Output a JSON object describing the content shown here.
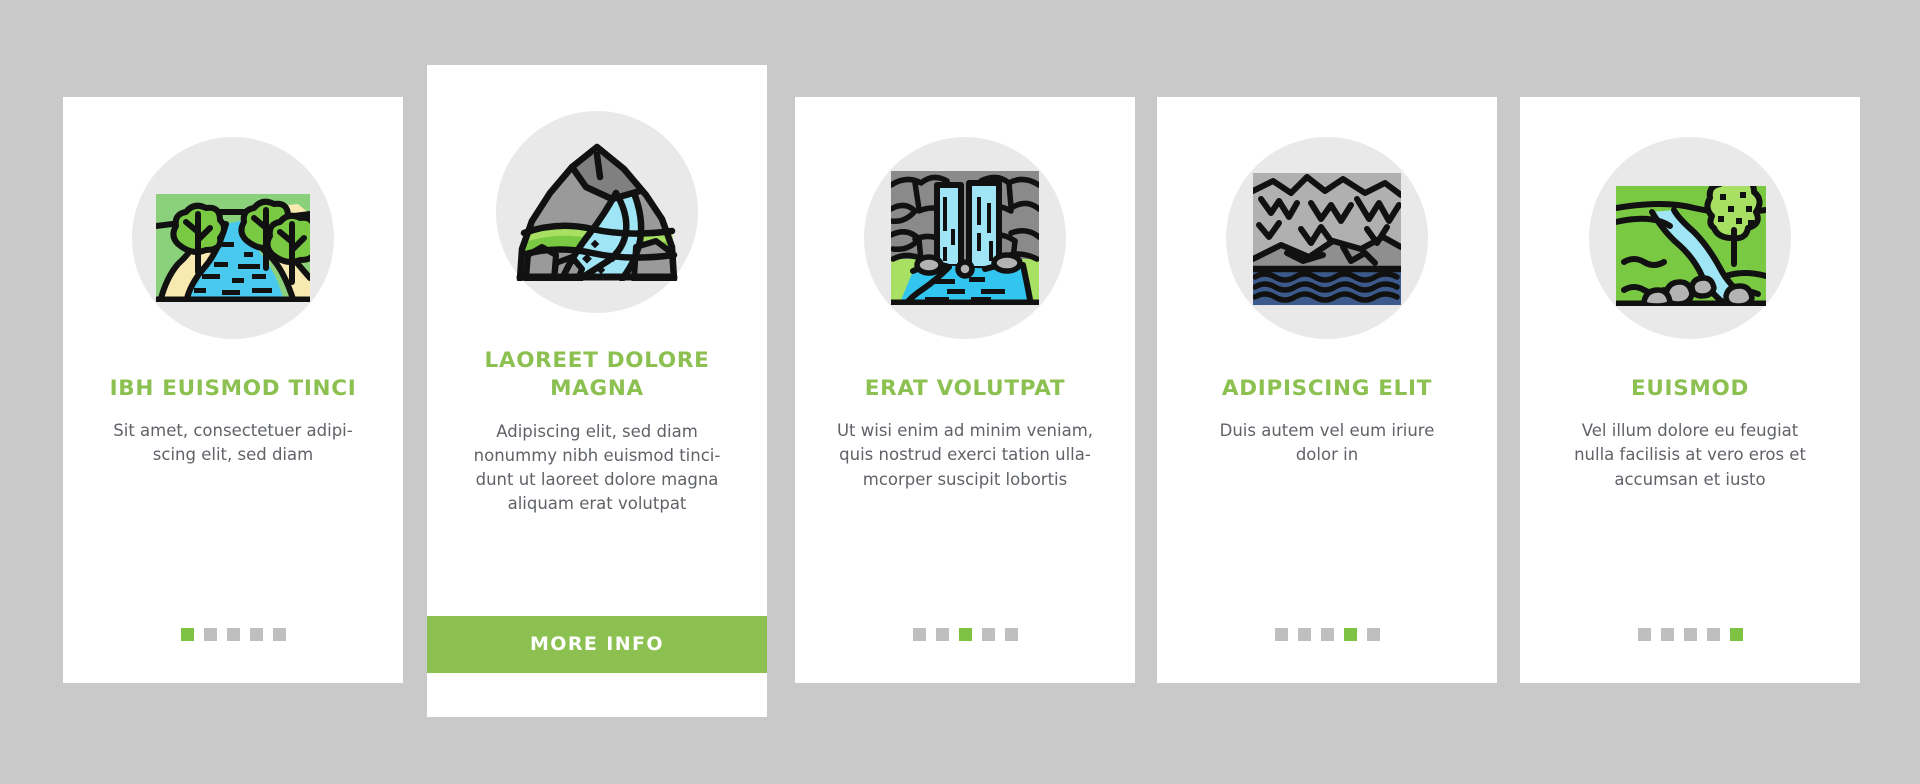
{
  "background_color": "#c9c9c9",
  "theme": {
    "accent_green": "#8cc152",
    "dot_active": "#7dc242",
    "dot_inactive": "#bfbfbf",
    "icon_circle": "#e9e9e9",
    "card_background": "#ffffff",
    "title_color": "#8cc152",
    "body_color": "#5f6368"
  },
  "cards": [
    {
      "icon_name": "river-with-trees-icon",
      "title": "IBH EUISMOD TINCI",
      "description": "Sit amet, consectetuer adipi-\nscing elit, sed diam",
      "featured": false,
      "dots": {
        "total": 5,
        "active_index": 0
      },
      "button": null
    },
    {
      "icon_name": "mountain-stream-icon",
      "title": "LAOREET DOLORE MAGNA",
      "description": "Adipiscing elit, sed diam\nnonummy nibh euismod tinci-\ndunt ut laoreet dolore magna\naliquam erat volutpat",
      "featured": true,
      "dots": null,
      "button": {
        "label": "MORE INFO"
      }
    },
    {
      "icon_name": "waterfall-icon",
      "title": "ERAT VOLUTPAT",
      "description": "Ut wisi enim ad minim veniam,\nquis nostrud exerci tation ulla-\nmcorper suscipit lobortis",
      "featured": false,
      "dots": {
        "total": 5,
        "active_index": 2
      },
      "button": null
    },
    {
      "icon_name": "rocky-cliff-sea-icon",
      "title": "ADIPISCING ELIT",
      "description": "Duis autem vel eum iriure\ndolor in",
      "featured": false,
      "dots": {
        "total": 5,
        "active_index": 3
      },
      "button": null
    },
    {
      "icon_name": "meadow-creek-tree-icon",
      "title": "EUISMOD",
      "description": "Vel illum dolore eu feugiat\nnulla facilisis at vero eros et\naccumsan et iusto",
      "featured": false,
      "dots": {
        "total": 5,
        "active_index": 4
      },
      "button": null
    }
  ]
}
